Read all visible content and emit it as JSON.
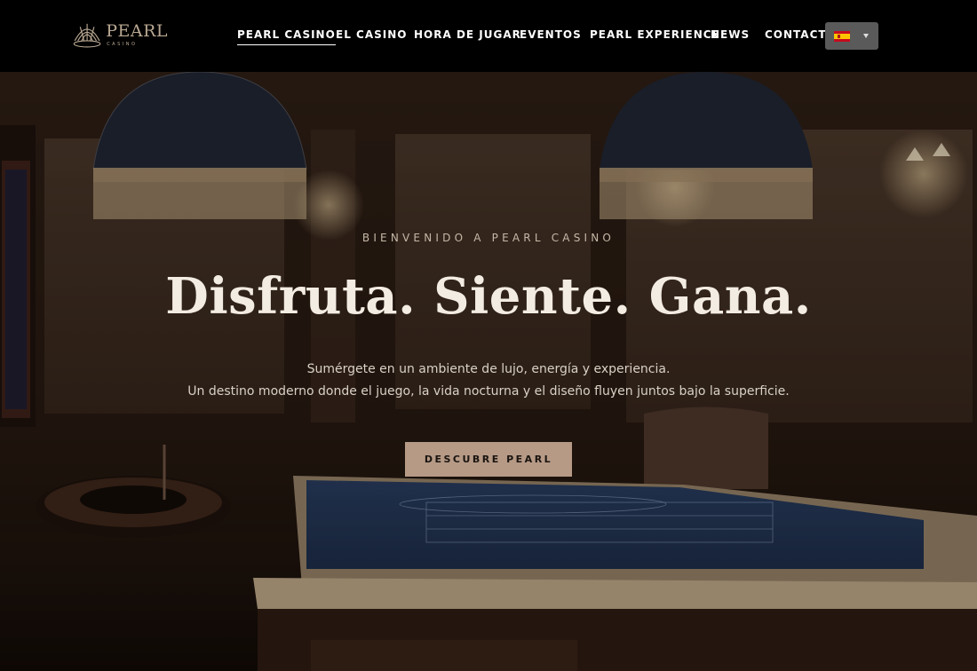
{
  "brand": {
    "name": "PEARL",
    "tagline": "CASINO"
  },
  "nav": {
    "items": [
      {
        "label": "PEARL CASINO",
        "active": true
      },
      {
        "label": "EL CASINO"
      },
      {
        "label": "HORA DE JUGAR"
      },
      {
        "label": "EVENTOS"
      },
      {
        "label": "PEARL EXPERIENCE"
      },
      {
        "label": "NEWS"
      },
      {
        "label": "CONTACT"
      }
    ],
    "language": {
      "icon": "spain-flag-icon",
      "dropdown_icon": "chevron-down-icon"
    }
  },
  "hero": {
    "kicker": "BIENVENIDO A PEARL CASINO",
    "headline": "Disfruta. Siente. Gana.",
    "subtitle_line1": "Sumérgete en un ambiente de lujo, energía y experiencia.",
    "subtitle_line2": "Un destino moderno donde el juego, la vida nocturna y el diseño fluyen juntos bajo la superficie.",
    "cta_label": "DESCUBRE PEARL"
  },
  "colors": {
    "header_bg": "#000000",
    "accent": "#b69a86",
    "logo": "#b9a892",
    "headline": "#f3ece3",
    "lang_bg": "#5a5a5a"
  }
}
